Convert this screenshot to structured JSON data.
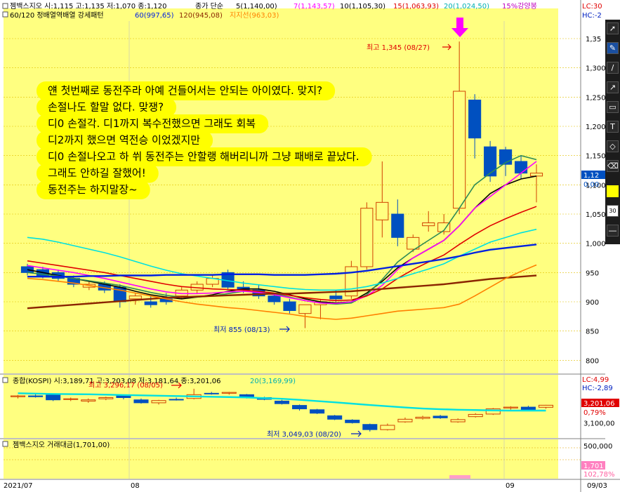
{
  "price_legend": {
    "line1": "젬백스지오 시:1,115 고:1,135 저:1,070 종:1,120",
    "ma_label": "종가 단순",
    "ma5": "5(1,140,00)",
    "ma7": "7(1,143,57)",
    "ma10": "10(1,105,30)",
    "ma15": "15(1,063,93)",
    "ma20": "20(1,024,50)",
    "strong_rise": "15%강양봉",
    "line2_title": "60/120 정배열역배열 강세패턴",
    "ma60": "60(997,65)",
    "ma120": "120(945,08)",
    "support": "지지선(963,03)"
  },
  "kospi_legend": {
    "line1": "종합(KOSPI) 시:3,189,71 고:3,203,08 저:3,181,64 종:3,201,06",
    "ma20": "20(3,169,99)"
  },
  "volume_legend": {
    "line1": "젬백스지오 거래대금(1,701,00)"
  },
  "right_labels": {
    "lc_top": "LC:30",
    "hc_top": "HC:-2",
    "price_current": "1,12",
    "price_ma": "0,00",
    "lc_kospi": "LC:4,99",
    "hc_kospi": "HC:-2,89",
    "kospi_current": "3,201,06",
    "kospi_pct": "0,79%",
    "vol_current": "1,701",
    "vol_pct": "102,78%",
    "vol_axis": "500,000"
  },
  "annotations": {
    "high_label": "최고 1,345 (08/27)",
    "low_label": "최저 855 (08/13)",
    "kospi_high_label": "최고 3,296,17 (08/05)",
    "kospi_low_label": "최저 3,049,03 (08/20)"
  },
  "comment_lines": [
    "얜 첫번째로 동전주라 아예 건들어서는 안되는 아이였다. 맞지?",
    "손절나도 할말 없다. 맞쟁?",
    "디0 손절각. 디1까지 복수전했으면 그래도 회복",
    "디2까지 했으면 역전승 이었겠지만",
    "디0 손절나오고 하 쒸 동전주는 안할랭 해버리니까 그냥 패배로 끝났다.",
    "그래도 안하길 잘했어!",
    "동전주는 하지말장~"
  ],
  "x_axis": {
    "labels": [
      "2021/07",
      "08",
      "09",
      "09/03"
    ]
  },
  "toolbar": {
    "label_30": "30"
  },
  "colors": {
    "background_yellow": "#ffff80",
    "highlight_yellow": "#ffff00",
    "up_candle": "#d04000",
    "down_candle": "#0050c0",
    "ma5": "#000000",
    "ma7": "#2e8b57",
    "ma10": "#ff00ff",
    "ma15": "#e00000",
    "ma20": "#00e0e0",
    "ma60": "#0020e0",
    "ma120": "#8b2500",
    "support": "#ff8000",
    "arrow_magenta": "#ff00ff"
  },
  "chart_data": [
    {
      "type": "candlestick",
      "title": "젬백스지오",
      "ylim": [
        780,
        1380
      ],
      "y_ticks": [
        800,
        850,
        900,
        950,
        1000,
        1050,
        1100,
        1150,
        1200,
        1250,
        1300,
        1350
      ],
      "y_tick_labels": [
        "800",
        "850",
        "900",
        "950",
        "1,000",
        "1,050",
        "1,100",
        "1,150",
        "1,200",
        "1,250",
        "1,300",
        "1,35"
      ],
      "candles": [
        {
          "o": 960,
          "h": 965,
          "l": 945,
          "c": 950
        },
        {
          "o": 955,
          "h": 960,
          "l": 940,
          "c": 945
        },
        {
          "o": 950,
          "h": 955,
          "l": 935,
          "c": 940
        },
        {
          "o": 940,
          "h": 945,
          "l": 925,
          "c": 930
        },
        {
          "o": 925,
          "h": 935,
          "l": 920,
          "c": 930
        },
        {
          "o": 930,
          "h": 935,
          "l": 915,
          "c": 920
        },
        {
          "o": 925,
          "h": 930,
          "l": 890,
          "c": 900
        },
        {
          "o": 905,
          "h": 915,
          "l": 895,
          "c": 910
        },
        {
          "o": 900,
          "h": 910,
          "l": 890,
          "c": 895
        },
        {
          "o": 905,
          "h": 915,
          "l": 895,
          "c": 900
        },
        {
          "o": 910,
          "h": 925,
          "l": 905,
          "c": 920
        },
        {
          "o": 920,
          "h": 935,
          "l": 915,
          "c": 930
        },
        {
          "o": 930,
          "h": 945,
          "l": 925,
          "c": 940
        },
        {
          "o": 950,
          "h": 955,
          "l": 920,
          "c": 925
        },
        {
          "o": 925,
          "h": 935,
          "l": 915,
          "c": 920
        },
        {
          "o": 920,
          "h": 930,
          "l": 905,
          "c": 910
        },
        {
          "o": 910,
          "h": 915,
          "l": 895,
          "c": 900
        },
        {
          "o": 900,
          "h": 905,
          "l": 880,
          "c": 885
        },
        {
          "o": 880,
          "h": 895,
          "l": 855,
          "c": 895
        },
        {
          "o": 895,
          "h": 905,
          "l": 870,
          "c": 900
        },
        {
          "o": 910,
          "h": 920,
          "l": 900,
          "c": 905
        },
        {
          "o": 910,
          "h": 970,
          "l": 905,
          "c": 960
        },
        {
          "o": 960,
          "h": 1070,
          "l": 955,
          "c": 1060
        },
        {
          "o": 1040,
          "h": 1140,
          "l": 1010,
          "c": 1070
        },
        {
          "o": 1050,
          "h": 1075,
          "l": 995,
          "c": 1010
        },
        {
          "o": 990,
          "h": 1015,
          "l": 985,
          "c": 1010
        },
        {
          "o": 1030,
          "h": 1055,
          "l": 1020,
          "c": 1035
        },
        {
          "o": 1020,
          "h": 1050,
          "l": 1015,
          "c": 1035
        },
        {
          "o": 1060,
          "h": 1345,
          "l": 1050,
          "c": 1260
        },
        {
          "o": 1245,
          "h": 1255,
          "l": 1145,
          "c": 1180
        },
        {
          "o": 1165,
          "h": 1175,
          "l": 1105,
          "c": 1115
        },
        {
          "o": 1160,
          "h": 1165,
          "l": 1115,
          "c": 1135
        },
        {
          "o": 1140,
          "h": 1150,
          "l": 1110,
          "c": 1120
        },
        {
          "o": 1115,
          "h": 1135,
          "l": 1070,
          "c": 1120
        }
      ],
      "moving_averages": [
        {
          "name": "5",
          "values": [
            955,
            950,
            945,
            940,
            935,
            930,
            925,
            918,
            912,
            908,
            905,
            908,
            912,
            918,
            922,
            922,
            918,
            912,
            905,
            900,
            898,
            900,
            915,
            935,
            958,
            975,
            990,
            1005,
            1030,
            1060,
            1085,
            1100,
            1110,
            1115
          ]
        },
        {
          "name": "7",
          "values": [
            950,
            947,
            944,
            940,
            936,
            932,
            928,
            922,
            916,
            911,
            908,
            908,
            910,
            914,
            918,
            918,
            914,
            908,
            902,
            898,
            896,
            898,
            912,
            938,
            968,
            988,
            1005,
            1022,
            1060,
            1100,
            1120,
            1138,
            1150,
            1143
          ]
        },
        {
          "name": "10",
          "values": [
            962,
            958,
            954,
            950,
            945,
            940,
            934,
            928,
            922,
            917,
            914,
            914,
            915,
            917,
            918,
            916,
            912,
            907,
            902,
            898,
            897,
            900,
            910,
            928,
            955,
            975,
            990,
            1005,
            1030,
            1060,
            1080,
            1100,
            1120,
            1140
          ]
        },
        {
          "name": "15",
          "values": [
            970,
            966,
            962,
            958,
            954,
            950,
            945,
            940,
            935,
            930,
            926,
            924,
            922,
            921,
            920,
            918,
            915,
            911,
            907,
            904,
            902,
            903,
            910,
            922,
            940,
            955,
            968,
            980,
            998,
            1015,
            1030,
            1042,
            1053,
            1063
          ]
        },
        {
          "name": "20",
          "values": [
            1010,
            1007,
            1002,
            996,
            990,
            984,
            977,
            969,
            961,
            954,
            948,
            944,
            940,
            936,
            932,
            929,
            926,
            923,
            921,
            920,
            920,
            922,
            926,
            932,
            940,
            948,
            956,
            965,
            978,
            990,
            1002,
            1010,
            1018,
            1024
          ]
        },
        {
          "name": "60",
          "values": [
            943,
            943,
            943,
            943,
            944,
            944,
            945,
            945,
            945,
            946,
            946,
            946,
            946,
            947,
            947,
            947,
            946,
            946,
            946,
            947,
            948,
            950,
            953,
            957,
            961,
            965,
            969,
            973,
            978,
            984,
            989,
            992,
            995,
            998
          ]
        },
        {
          "name": "120",
          "values": [
            889,
            891,
            893,
            895,
            897,
            899,
            901,
            903,
            905,
            907,
            908,
            909,
            910,
            911,
            912,
            913,
            914,
            914,
            915,
            916,
            917,
            918,
            920,
            922,
            924,
            926,
            928,
            930,
            933,
            936,
            939,
            941,
            943,
            945
          ]
        },
        {
          "name": "지지선",
          "values": [
            940,
            938,
            935,
            932,
            928,
            924,
            920,
            915,
            910,
            905,
            900,
            896,
            893,
            890,
            888,
            885,
            882,
            879,
            875,
            872,
            870,
            872,
            876,
            880,
            884,
            886,
            888,
            890,
            896,
            910,
            925,
            940,
            952,
            963
          ]
        }
      ]
    },
    {
      "type": "candlestick",
      "title": "종합(KOSPI)",
      "ylim": [
        3020,
        3320
      ],
      "y_ticks": [
        3100
      ],
      "y_tick_labels": [
        "3,100,00"
      ],
      "candles": [
        {
          "o": 3250,
          "h": 3260,
          "l": 3240,
          "c": 3255
        },
        {
          "o": 3255,
          "h": 3265,
          "l": 3245,
          "c": 3250
        },
        {
          "o": 3260,
          "h": 3265,
          "l": 3225,
          "c": 3232
        },
        {
          "o": 3235,
          "h": 3245,
          "l": 3225,
          "c": 3238
        },
        {
          "o": 3225,
          "h": 3240,
          "l": 3215,
          "c": 3232
        },
        {
          "o": 3238,
          "h": 3250,
          "l": 3230,
          "c": 3245
        },
        {
          "o": 3255,
          "h": 3260,
          "l": 3235,
          "c": 3245
        },
        {
          "o": 3232,
          "h": 3240,
          "l": 3210,
          "c": 3215
        },
        {
          "o": 3215,
          "h": 3232,
          "l": 3205,
          "c": 3228
        },
        {
          "o": 3235,
          "h": 3245,
          "l": 3228,
          "c": 3232
        },
        {
          "o": 3240,
          "h": 3296,
          "l": 3235,
          "c": 3262
        },
        {
          "o": 3270,
          "h": 3278,
          "l": 3262,
          "c": 3268
        },
        {
          "o": 3270,
          "h": 3278,
          "l": 3262,
          "c": 3275
        },
        {
          "o": 3262,
          "h": 3266,
          "l": 3240,
          "c": 3245
        },
        {
          "o": 3245,
          "h": 3250,
          "l": 3230,
          "c": 3235
        },
        {
          "o": 3225,
          "h": 3232,
          "l": 3205,
          "c": 3210
        },
        {
          "o": 3200,
          "h": 3205,
          "l": 3170,
          "c": 3180
        },
        {
          "o": 3175,
          "h": 3180,
          "l": 3150,
          "c": 3155
        },
        {
          "o": 3140,
          "h": 3145,
          "l": 3115,
          "c": 3120
        },
        {
          "o": 3115,
          "h": 3120,
          "l": 3095,
          "c": 3100
        },
        {
          "o": 3090,
          "h": 3095,
          "l": 3049,
          "c": 3060
        },
        {
          "o": 3060,
          "h": 3095,
          "l": 3055,
          "c": 3085
        },
        {
          "o": 3105,
          "h": 3130,
          "l": 3100,
          "c": 3120
        },
        {
          "o": 3125,
          "h": 3140,
          "l": 3118,
          "c": 3132
        },
        {
          "o": 3138,
          "h": 3145,
          "l": 3122,
          "c": 3128
        },
        {
          "o": 3105,
          "h": 3125,
          "l": 3100,
          "c": 3118
        },
        {
          "o": 3135,
          "h": 3155,
          "l": 3130,
          "c": 3148
        },
        {
          "o": 3150,
          "h": 3185,
          "l": 3145,
          "c": 3180
        },
        {
          "o": 3185,
          "h": 3195,
          "l": 3175,
          "c": 3190
        },
        {
          "o": 3190,
          "h": 3198,
          "l": 3170,
          "c": 3175
        },
        {
          "o": 3189,
          "h": 3203,
          "l": 3181,
          "c": 3201
        }
      ],
      "moving_averages": [
        {
          "name": "20",
          "values": [
            3270,
            3268,
            3266,
            3265,
            3264,
            3262,
            3260,
            3258,
            3256,
            3254,
            3252,
            3250,
            3248,
            3246,
            3242,
            3238,
            3232,
            3225,
            3218,
            3210,
            3202,
            3195,
            3188,
            3182,
            3178,
            3175,
            3173,
            3171,
            3170,
            3170,
            3170
          ]
        }
      ]
    },
    {
      "type": "bar",
      "title": "젬백스지오 거래대금",
      "y_ticks": [
        500000
      ],
      "y_tick_labels": [
        "500,000"
      ],
      "values": [
        1701
      ]
    }
  ]
}
